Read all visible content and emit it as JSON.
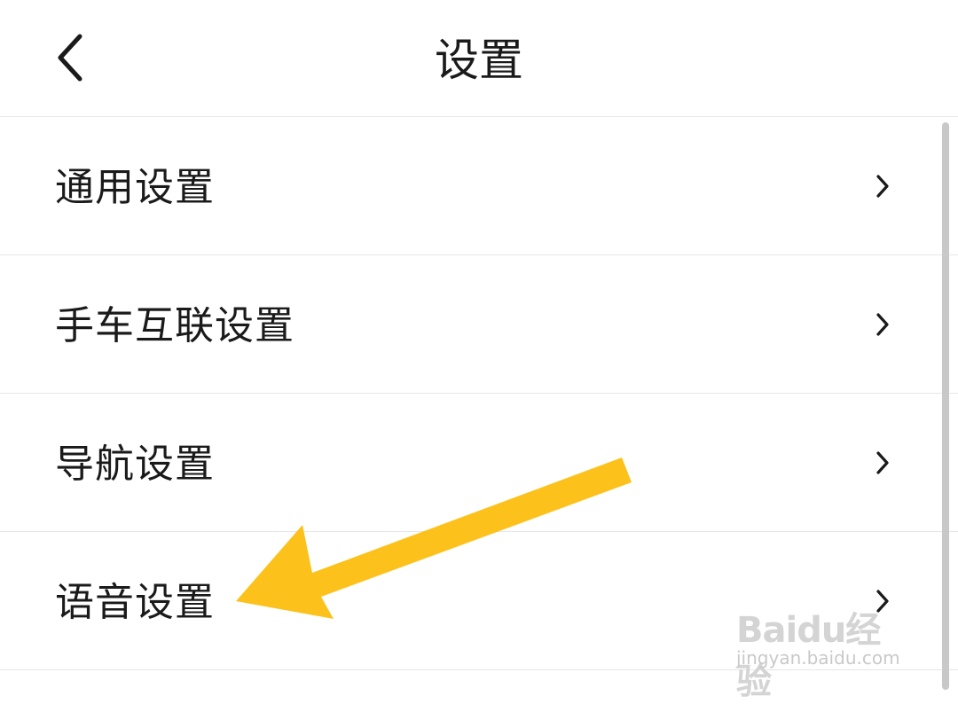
{
  "header": {
    "title": "设置",
    "back_icon": "chevron-left-icon"
  },
  "settings": {
    "items": [
      {
        "label": "通用设置",
        "icon": "chevron-right-icon"
      },
      {
        "label": "手车互联设置",
        "icon": "chevron-right-icon"
      },
      {
        "label": "导航设置",
        "icon": "chevron-right-icon"
      },
      {
        "label": "语音设置",
        "icon": "chevron-right-icon"
      }
    ]
  },
  "annotation": {
    "arrow_color": "#fcc21b"
  },
  "watermark": {
    "logo_text": "Baidu经验",
    "url": "jingyan.baidu.com"
  }
}
